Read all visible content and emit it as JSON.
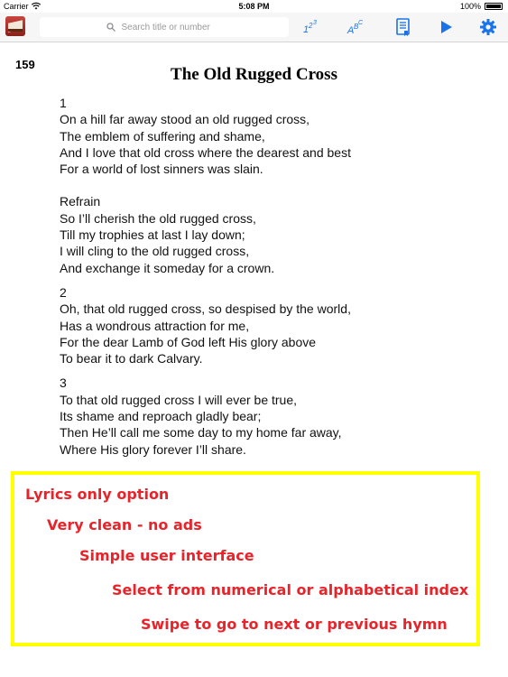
{
  "status_bar": {
    "carrier": "Carrier",
    "time": "5:08 PM",
    "battery": "100%"
  },
  "toolbar": {
    "search_placeholder": "Search title or number",
    "icons": [
      "app-icon",
      "search-icon",
      "numerical-index-icon",
      "alphabetical-index-icon",
      "lyrics-page-icon",
      "play-icon",
      "gear-icon"
    ]
  },
  "hymn": {
    "number": "159",
    "title": "The Old Rugged Cross",
    "stanzas": [
      {
        "label": "1",
        "lines": [
          "On a hill far away stood an old rugged cross,",
          "The emblem of suffering and shame,",
          "And I love that old cross where the dearest and best",
          "For a world of lost sinners was slain."
        ]
      },
      {
        "label": "Refrain",
        "lines": [
          "So I’ll cherish the old rugged cross,",
          "Till my trophies at last I lay down;",
          "I will cling to the old rugged cross,",
          "And exchange it someday for a crown."
        ]
      },
      {
        "label": "2",
        "lines": [
          "Oh, that old rugged cross, so despised by the world,",
          "Has a wondrous attraction for me,",
          "For the dear Lamb of God left His glory above",
          "To bear it to dark Calvary."
        ]
      },
      {
        "label": "3",
        "lines": [
          "To that old rugged cross I will ever be true,",
          "Its shame and reproach gladly bear;",
          "Then He’ll call me some day to my home far away,",
          "Where His glory forever I’ll share."
        ]
      }
    ]
  },
  "features": [
    "Lyrics only option",
    "Very clean - no ads",
    "Simple user interface",
    "Select from numerical or alphabetical index",
    "Swipe to go to next or previous hymn"
  ],
  "colors": {
    "accent": "#1a73e8",
    "feature_text": "#e8232a",
    "feature_border": "#ffff00"
  }
}
